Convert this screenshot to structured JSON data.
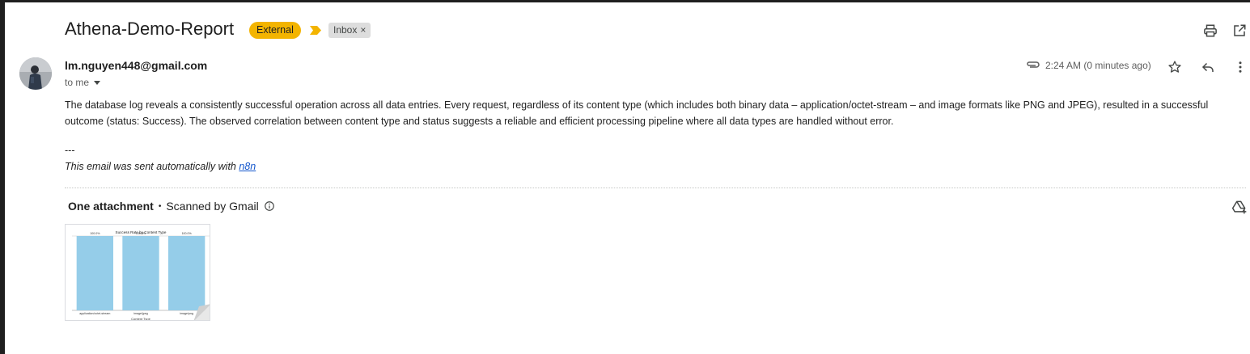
{
  "email": {
    "subject": "Athena-Demo-Report",
    "labels": {
      "external": "External",
      "inbox": "Inbox",
      "remove_symbol": "×"
    },
    "sender": "lm.nguyen448@gmail.com",
    "recipient_text": "to me",
    "time": "2:24 AM (0 minutes ago)",
    "body": "The database log reveals a consistently successful operation across all data entries. Every request, regardless of its content type (which includes both binary data – application/octet-stream – and image formats like PNG and JPEG), resulted in a successful outcome (status: Success). The observed correlation between content type and status suggests a reliable and efficient processing pipeline where all data types are handled without error.",
    "signature_dash": "---",
    "signature_prefix": "This email was sent automatically with ",
    "signature_link": "n8n"
  },
  "attachments": {
    "title": "One attachment",
    "separator": "•",
    "scanned": "Scanned by Gmail"
  },
  "icons": [
    "print-icon",
    "open-new-window-icon",
    "paperclip-icon",
    "star-icon",
    "reply-icon",
    "more-vert-icon",
    "chevron-down-icon",
    "info-icon",
    "add-to-drive-icon",
    "importance-marker-icon"
  ],
  "colors": {
    "external_label": "#f3b400",
    "importance": "#f3b400",
    "link": "#1155cc",
    "bar": "#95cde9"
  },
  "chart_data": {
    "type": "bar",
    "title": "Success Rate by Content Type",
    "xlabel": "Content Type",
    "ylabel": "",
    "categories": [
      "application/octet-stream",
      "image/jpeg",
      "image/png"
    ],
    "values": [
      100,
      100,
      100
    ],
    "data_labels": [
      "100.0%",
      "100.0%",
      "100.0%"
    ],
    "ylim": [
      0,
      100
    ]
  }
}
